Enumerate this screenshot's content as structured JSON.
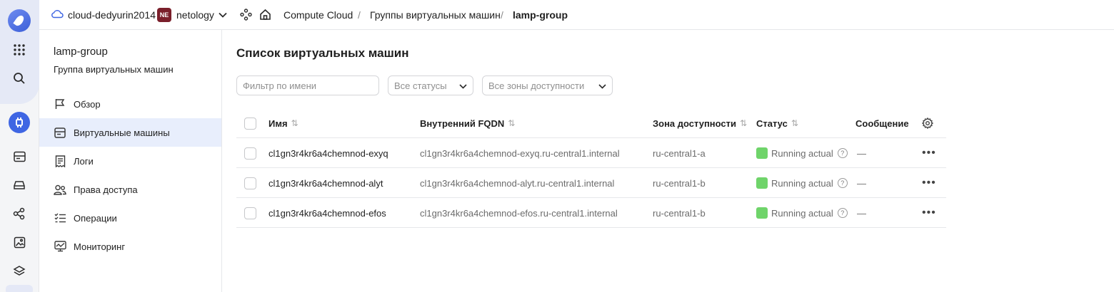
{
  "topbar": {
    "cloud_name": "cloud-dedyurin2014",
    "org_badge": "NE",
    "org_name": "netology",
    "breadcrumbs": [
      "Compute Cloud",
      "Группы виртуальных машин",
      "lamp-group"
    ],
    "separator": "/"
  },
  "sidebar": {
    "title": "lamp-group",
    "subtitle": "Группа виртуальных машин",
    "items": [
      {
        "label": "Обзор",
        "icon": "flag-icon",
        "active": false
      },
      {
        "label": "Виртуальные машины",
        "icon": "server-icon",
        "active": true
      },
      {
        "label": "Логи",
        "icon": "receipt-icon",
        "active": false
      },
      {
        "label": "Права доступа",
        "icon": "users-icon",
        "active": false
      },
      {
        "label": "Операции",
        "icon": "list-icon",
        "active": false
      },
      {
        "label": "Мониторинг",
        "icon": "monitor-icon",
        "active": false
      }
    ]
  },
  "main": {
    "title": "Список виртуальных машин",
    "filter_placeholder": "Фильтр по имени",
    "status_select": "Все статусы",
    "zone_select": "Все зоны доступности",
    "columns": {
      "name": "Имя",
      "fqdn": "Внутренний FQDN",
      "zone": "Зона доступности",
      "status": "Статус",
      "message": "Сообщение"
    },
    "rows": [
      {
        "name": "cl1gn3r4kr6a4chemnod-exyq",
        "fqdn": "cl1gn3r4kr6a4chemnod-exyq.ru-central1.internal",
        "zone": "ru-central1-a",
        "status": "Running actual",
        "message": "—"
      },
      {
        "name": "cl1gn3r4kr6a4chemnod-alyt",
        "fqdn": "cl1gn3r4kr6a4chemnod-alyt.ru-central1.internal",
        "zone": "ru-central1-b",
        "status": "Running actual",
        "message": "—"
      },
      {
        "name": "cl1gn3r4kr6a4chemnod-efos",
        "fqdn": "cl1gn3r4kr6a4chemnod-efos.ru-central1.internal",
        "zone": "ru-central1-b",
        "status": "Running actual",
        "message": "—"
      }
    ],
    "help_glyph": "?",
    "more_glyph": "•••"
  },
  "colors": {
    "accent": "#3f66e3",
    "status_running": "#6fd46a",
    "active_nav": "#e8eefc"
  }
}
